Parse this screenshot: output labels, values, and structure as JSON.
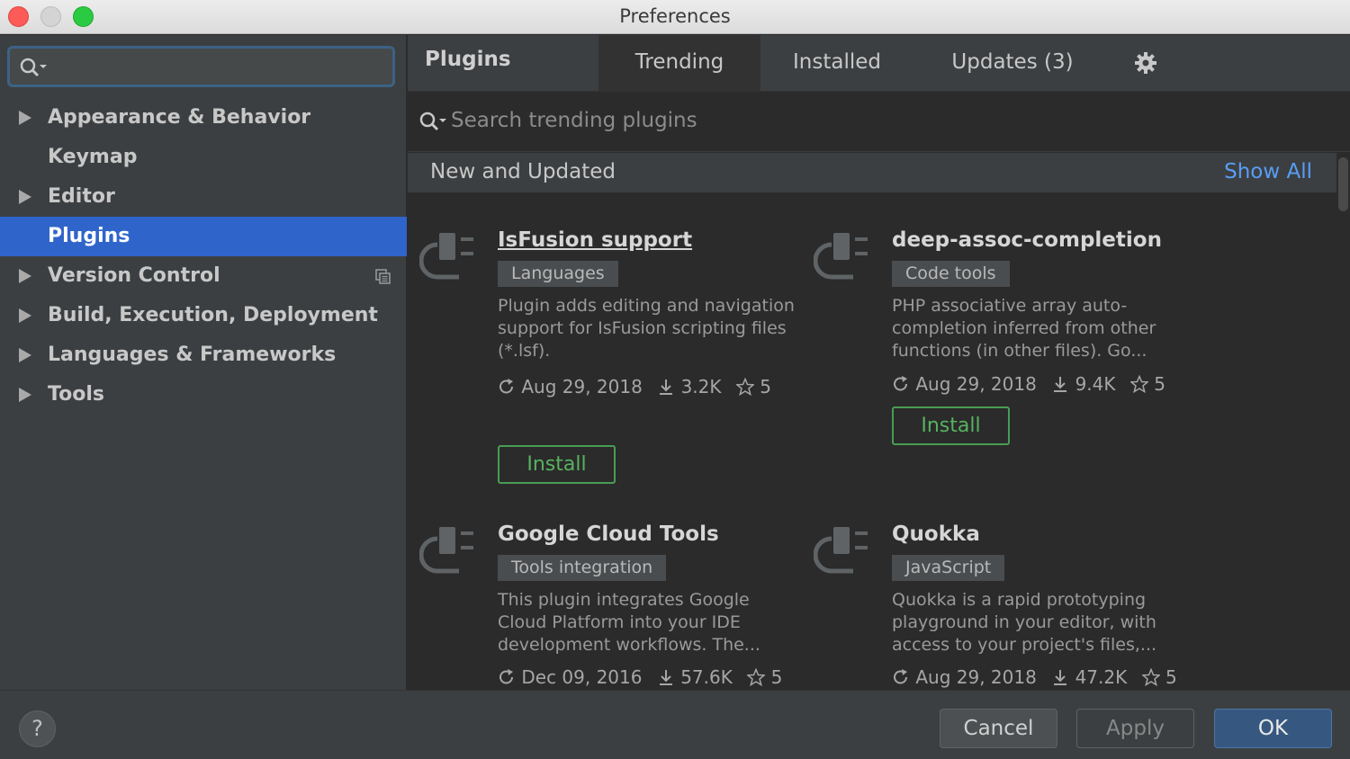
{
  "window": {
    "title": "Preferences"
  },
  "sidebar": {
    "search": {
      "placeholder": "",
      "icon": "search-icon"
    },
    "items": [
      {
        "label": "Appearance & Behavior",
        "expandable": true
      },
      {
        "label": "Keymap",
        "expandable": false
      },
      {
        "label": "Editor",
        "expandable": true
      },
      {
        "label": "Plugins",
        "expandable": false,
        "selected": true
      },
      {
        "label": "Version Control",
        "expandable": true
      },
      {
        "label": "Build, Execution, Deployment",
        "expandable": true
      },
      {
        "label": "Languages & Frameworks",
        "expandable": true
      },
      {
        "label": "Tools",
        "expandable": true
      }
    ]
  },
  "main": {
    "title": "Plugins",
    "tabs": [
      {
        "label": "Trending",
        "active": true
      },
      {
        "label": "Installed",
        "active": false
      },
      {
        "label": "Updates (3)",
        "active": false
      }
    ],
    "search_placeholder": "Search trending plugins",
    "section": {
      "label": "New and Updated",
      "show_all": "Show All"
    },
    "plugins": [
      {
        "name": "IsFusion support",
        "tag": "Languages",
        "description": "Plugin adds editing and navigation support for IsFusion scripting files (*.lsf).",
        "date": "Aug 29, 2018",
        "downloads": "3.2K",
        "rating": "5",
        "install_label": "Install"
      },
      {
        "name": "deep-assoc-completion",
        "tag": "Code tools",
        "description": "PHP associative array auto-completion inferred from other functions (in other files). Go...",
        "date": "Aug 29, 2018",
        "downloads": "9.4K",
        "rating": "5",
        "install_label": "Install"
      },
      {
        "name": "Google Cloud Tools",
        "tag": "Tools integration",
        "description": "This plugin integrates Google Cloud Platform into your IDE development workflows. The...",
        "date": "Dec 09, 2016",
        "downloads": "57.6K",
        "rating": "5"
      },
      {
        "name": "Quokka",
        "tag": "JavaScript",
        "description": "Quokka is a rapid prototyping playground in your editor, with access to your project's files,...",
        "date": "Aug 29, 2018",
        "downloads": "47.2K",
        "rating": "5"
      }
    ]
  },
  "footer": {
    "help": "?",
    "cancel": "Cancel",
    "apply": "Apply",
    "ok": "OK"
  },
  "colors": {
    "selection": "#2f65ca",
    "install_green": "#499c54",
    "link_blue": "#589df6",
    "ok_button": "#365880"
  }
}
